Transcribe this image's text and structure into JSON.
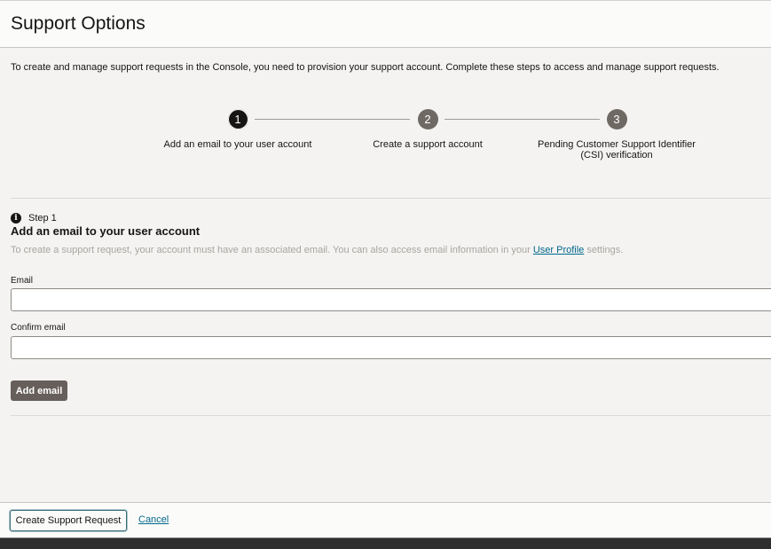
{
  "header": {
    "title": "Support Options"
  },
  "intro": "To create and manage support requests in the Console, you need to provision your support account. Complete these steps to access and manage support requests.",
  "stepper": {
    "steps": [
      {
        "number": "1",
        "label": "Add an email to your user account",
        "state": "active"
      },
      {
        "number": "2",
        "label": "Create a support account",
        "state": "pending"
      },
      {
        "number": "3",
        "label": "Pending Customer Support Identifier (CSI) verification",
        "state": "pending"
      }
    ]
  },
  "step_section": {
    "kicker": "Step 1",
    "title": "Add an email to your user account",
    "description_before": "To create a support request, your account must have an associated email. You can also access email information in your ",
    "description_link": "User Profile",
    "description_after": " settings.",
    "email_label": "Email",
    "email_value": "",
    "confirm_label": "Confirm email",
    "confirm_value": "",
    "add_button": "Add email"
  },
  "footer": {
    "create_button": "Create Support Request",
    "cancel_link": "Cancel"
  },
  "icons": {
    "info": "info-icon"
  },
  "colors": {
    "active_step": "#161513",
    "pending_step": "#6f6964",
    "link": "#00688c",
    "primary_button": "#675f5b"
  }
}
